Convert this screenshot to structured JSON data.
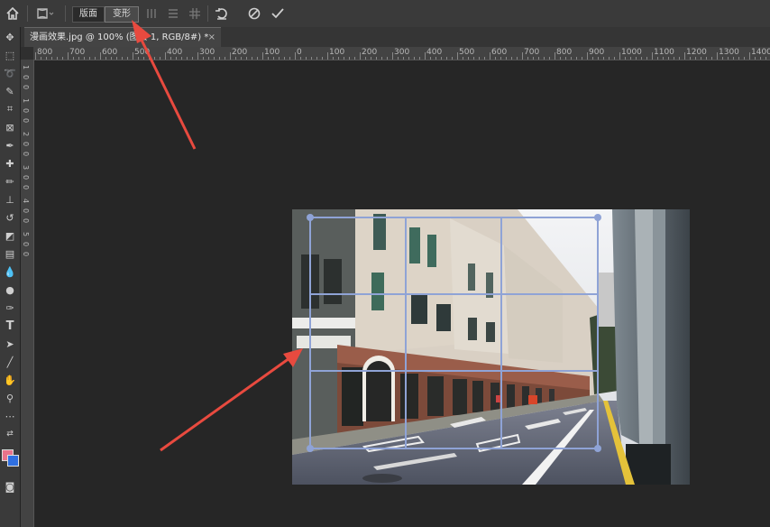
{
  "options_bar": {
    "home_icon": "home-icon",
    "warp_icon": "warp-icon",
    "mode_buttons": [
      "版面",
      "变形"
    ],
    "selected_mode": "变形",
    "icons": [
      "split-vertical-icon",
      "split-horizontal-icon",
      "grid-icon",
      "reset-icon",
      "cancel-icon",
      "commit-icon"
    ]
  },
  "document": {
    "tab_title": "漫画效果.jpg @ 100% (图层 1, RGB/8#) *",
    "close": "×"
  },
  "ruler": {
    "h_labels": [
      "800",
      "700",
      "600",
      "500",
      "400",
      "300",
      "200",
      "100",
      "0",
      "100",
      "200",
      "300",
      "400",
      "500",
      "600",
      "700",
      "800",
      "900",
      "1000",
      "1100",
      "1200",
      "1300",
      "1400"
    ],
    "v_labels": [
      "1",
      "0",
      "0",
      "1",
      "0",
      "0",
      "2",
      "0",
      "0",
      "3",
      "0",
      "0",
      "4",
      "0",
      "0",
      "5",
      "0",
      "0"
    ]
  },
  "tools": [
    "move",
    "marquee",
    "lasso",
    "quick-select",
    "crop",
    "frame",
    "eyedropper",
    "healing",
    "brush",
    "stamp",
    "history-brush",
    "eraser",
    "gradient",
    "blur",
    "dodge",
    "pen",
    "type",
    "path-select",
    "line",
    "hand",
    "zoom",
    "more",
    "swap-colors",
    "foreground-color",
    "quick-mask"
  ],
  "colors": {
    "foreground": "#e8738b",
    "background": "#2f6fe0",
    "grid": "#8fa3d6",
    "arrow": "#e84a3f"
  }
}
